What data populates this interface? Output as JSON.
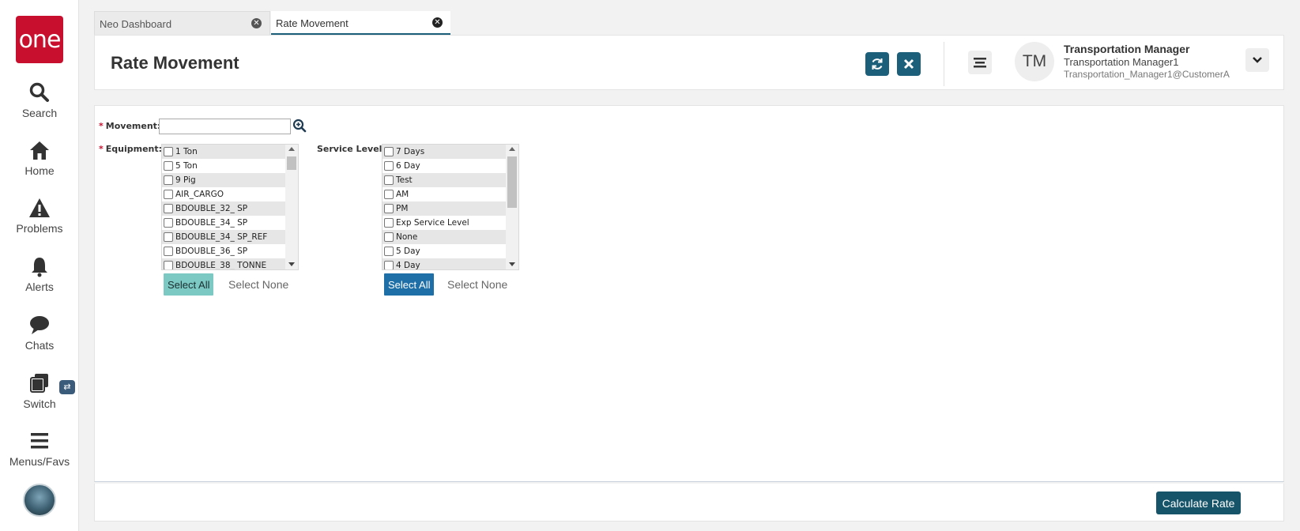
{
  "app": {
    "logo_text": "one"
  },
  "sidebar": {
    "items": [
      {
        "label": "Search",
        "icon": "search-icon"
      },
      {
        "label": "Home",
        "icon": "home-icon"
      },
      {
        "label": "Problems",
        "icon": "warning-icon"
      },
      {
        "label": "Alerts",
        "icon": "bell-icon"
      },
      {
        "label": "Chats",
        "icon": "chat-icon"
      },
      {
        "label": "Switch",
        "icon": "switch-icon"
      },
      {
        "label": "Menus/Favs",
        "icon": "hamburger-icon"
      }
    ],
    "switch_badge": "⇄"
  },
  "tabs": [
    {
      "label": "Neo Dashboard",
      "active": false
    },
    {
      "label": "Rate Movement",
      "active": true
    }
  ],
  "header": {
    "title": "Rate Movement",
    "user": {
      "initials": "TM",
      "role": "Transportation Manager",
      "name": "Transportation Manager1",
      "email": "Transportation_Manager1@CustomerA"
    }
  },
  "form": {
    "movement_label": "Movement:",
    "movement_value": "",
    "equipment_label": "Equipment:",
    "service_level_label": "Service Level:",
    "equipment_options": [
      "1 Ton",
      "5 Ton",
      "9 Pig",
      "AIR_CARGO",
      "BDOUBLE_32_ SP",
      "BDOUBLE_34_ SP",
      "BDOUBLE_34_ SP_REF",
      "BDOUBLE_36_ SP",
      "BDOUBLE_38_ TONNE"
    ],
    "service_level_options": [
      "7 Days",
      "6 Day",
      "Test",
      "AM",
      "PM",
      "Exp Service Level",
      "None",
      "5 Day",
      "4 Day"
    ],
    "select_all_label": "Select All",
    "select_none_label": "Select None"
  },
  "footer": {
    "calculate_label": "Calculate Rate"
  },
  "colors": {
    "brand_red": "#c8102e",
    "primary_teal": "#1c5f7a",
    "select_all_teal": "#7cc9c3",
    "select_all_blue": "#1e6fa8"
  }
}
